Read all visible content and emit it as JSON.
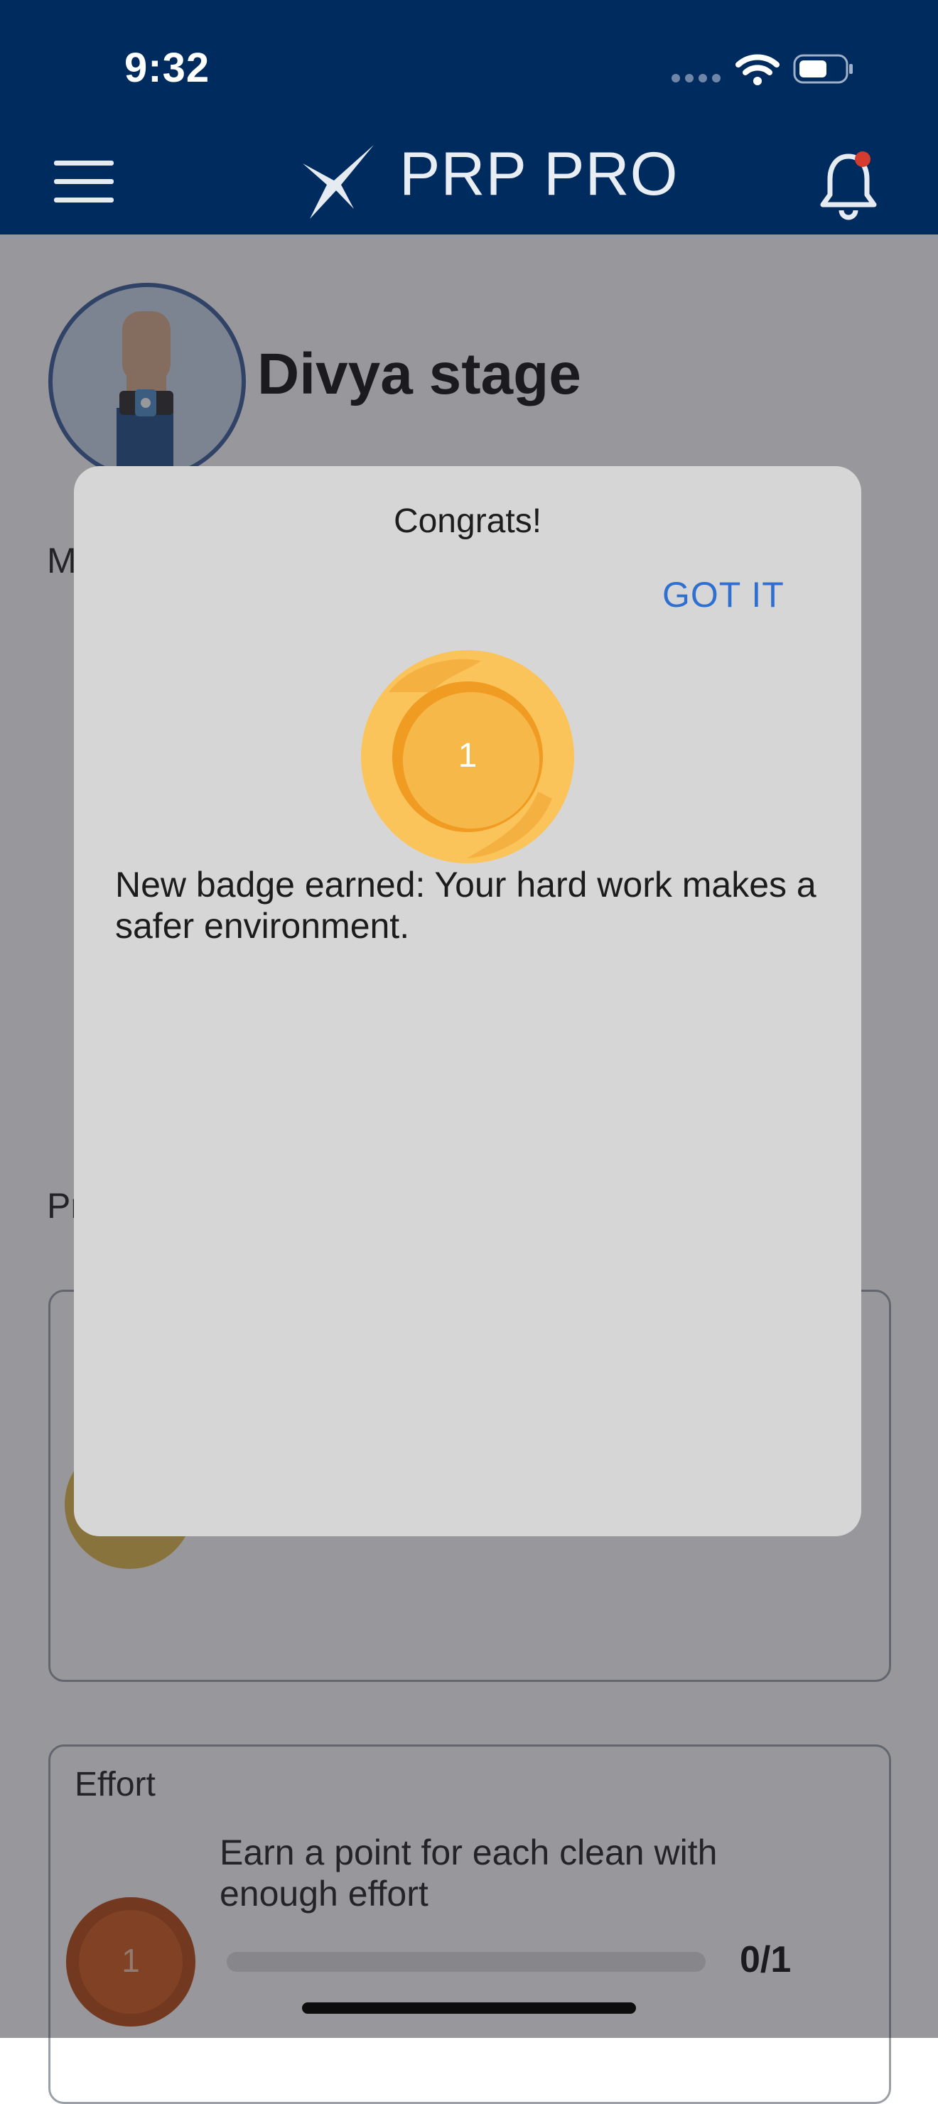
{
  "status_bar": {
    "time": "9:32"
  },
  "header": {
    "app_title": "PRP PRO"
  },
  "profile": {
    "name": "Divya stage"
  },
  "background": {
    "section_fragment_top": "M",
    "section_fragment_progress": "Pr",
    "effort_card": {
      "title": "Effort",
      "description": "Earn a point for each clean with enough effort",
      "badge_level": "1",
      "progress": "0/1",
      "progress_fraction": 0
    }
  },
  "dialog": {
    "title": "Congrats!",
    "action_label": "GOT IT",
    "badge_level": "1",
    "message": "New badge earned: Your hard work makes a safer environment."
  },
  "colors": {
    "navbar": "#002b5f",
    "accent_link": "#2f6fd0",
    "badge_gold": "#f5b94a",
    "badge_bronze": "#d1591c"
  }
}
